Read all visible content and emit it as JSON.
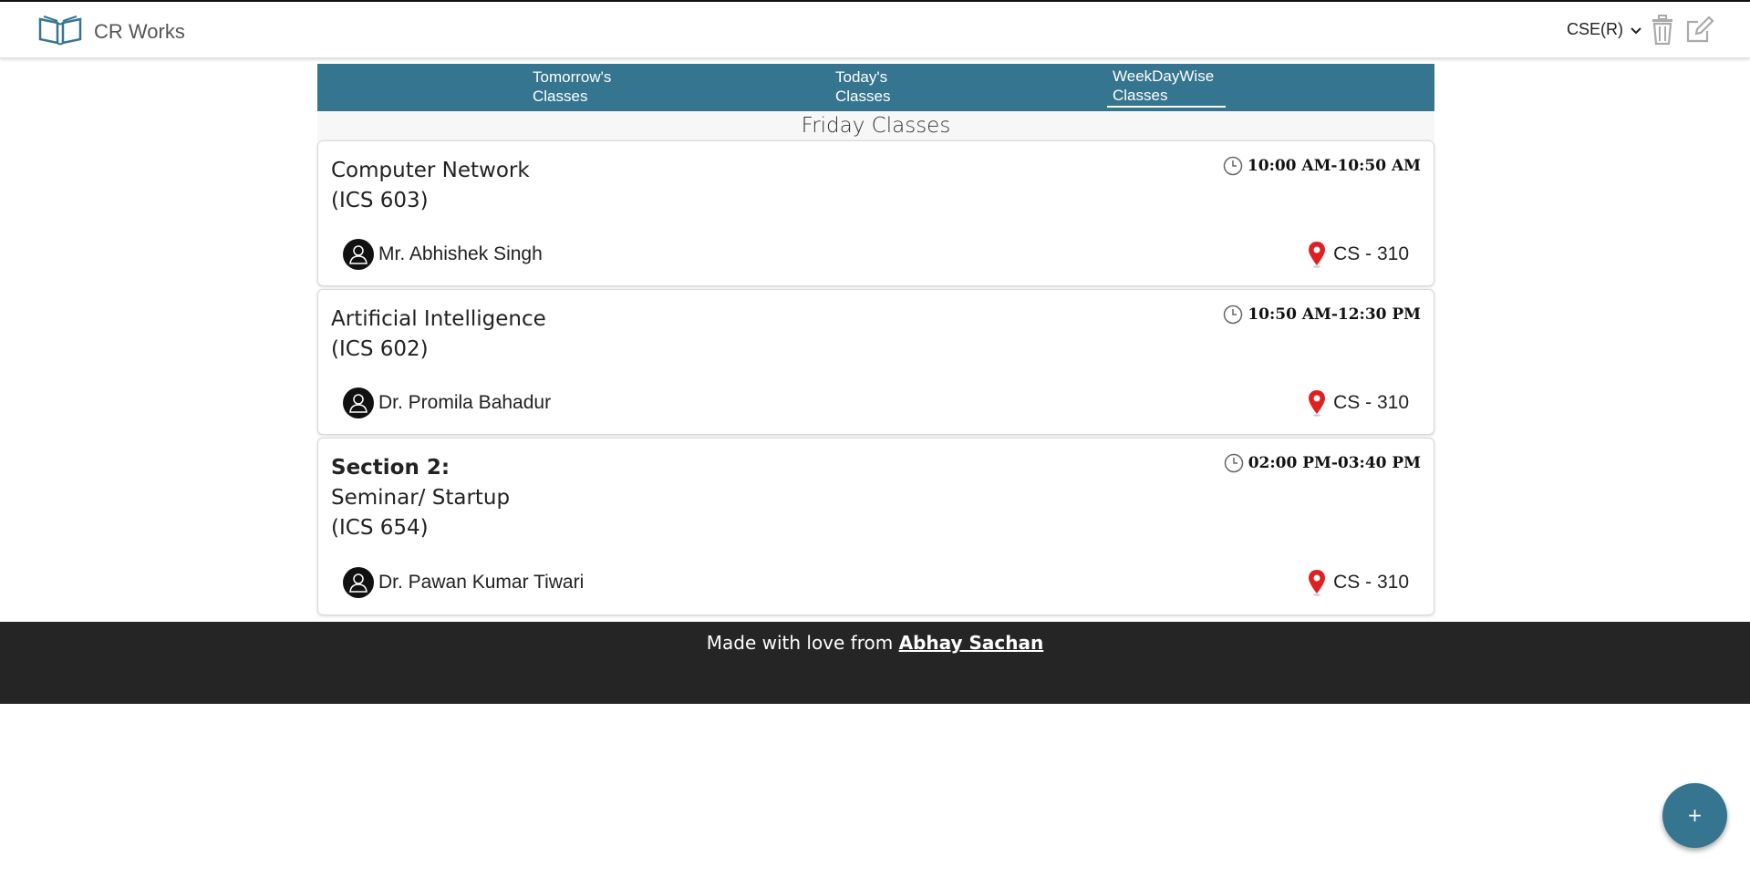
{
  "header": {
    "brand": "CR Works",
    "branch": "CSE(R)",
    "delete_icon": "trash-icon",
    "edit_icon": "edit-icon"
  },
  "tabs": [
    {
      "line1": "Tomorrow's",
      "line2": "Classes",
      "active": false
    },
    {
      "line1": "Today's",
      "line2": "Classes",
      "active": false
    },
    {
      "line1": "WeekDayWise",
      "line2": "Classes",
      "active": true
    }
  ],
  "day_title": "Friday Classes",
  "classes": [
    {
      "section": "",
      "subject": "Computer Network",
      "code": "(ICS 603)",
      "time": "10:00 AM-10:50 AM",
      "teacher": "Mr. Abhishek Singh",
      "room": "CS - 310"
    },
    {
      "section": "",
      "subject": "Artificial Intelligence",
      "code": "(ICS 602)",
      "time": "10:50 AM-12:30 PM",
      "teacher": "Dr. Promila Bahadur",
      "room": "CS - 310"
    },
    {
      "section": "Section 2:",
      "subject": "Seminar/ Startup",
      "code": "(ICS 654)",
      "time": "02:00 PM-03:40 PM",
      "teacher": "Dr. Pawan Kumar Tiwari",
      "room": "CS - 310"
    }
  ],
  "footer": {
    "prefix": "Made with love from",
    "author": "Abhay Sachan"
  },
  "fab": "+",
  "colors": {
    "accent": "#35758f",
    "footer_bg": "#252525",
    "pin": "#e02020"
  }
}
